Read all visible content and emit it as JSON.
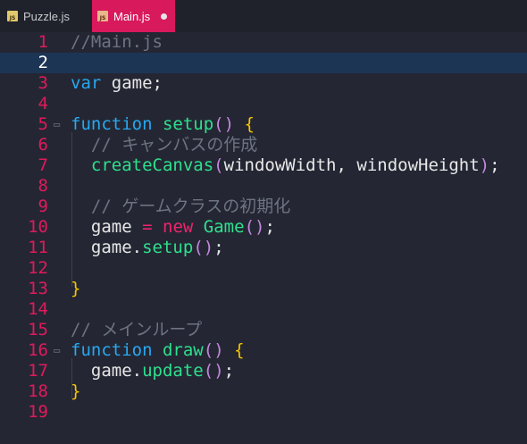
{
  "tabs": [
    {
      "label": "Puzzle.js",
      "icon": "js-file-icon",
      "icon_text": "JS",
      "active": false
    },
    {
      "label": "Main.js",
      "icon": "js-file-icon",
      "icon_text": "JS",
      "active": true,
      "modified": true
    }
  ],
  "editor": {
    "current_line": 2,
    "lines": [
      {
        "n": "1",
        "text": "//Main.js"
      },
      {
        "n": "2",
        "text": ""
      },
      {
        "n": "3",
        "text": "var game;"
      },
      {
        "n": "4",
        "text": ""
      },
      {
        "n": "5",
        "text": "function setup() {"
      },
      {
        "n": "6",
        "text": "  // キャンバスの作成"
      },
      {
        "n": "7",
        "text": "  createCanvas(windowWidth, windowHeight);"
      },
      {
        "n": "8",
        "text": ""
      },
      {
        "n": "9",
        "text": "  // ゲームクラスの初期化"
      },
      {
        "n": "10",
        "text": "  game = new Game();"
      },
      {
        "n": "11",
        "text": "  game.setup();"
      },
      {
        "n": "12",
        "text": ""
      },
      {
        "n": "13",
        "text": "}"
      },
      {
        "n": "14",
        "text": ""
      },
      {
        "n": "15",
        "text": "// メインループ"
      },
      {
        "n": "16",
        "text": "function draw() {"
      },
      {
        "n": "17",
        "text": "  game.update();"
      },
      {
        "n": "18",
        "text": "}"
      },
      {
        "n": "19",
        "text": ""
      }
    ]
  },
  "colors": {
    "background": "#242733",
    "active_tab": "#d8195b",
    "line_number": "#e01a5c",
    "keyword": "#27a8f0",
    "function": "#2ee08e",
    "bracket": "#f5c500",
    "paren": "#c586e0",
    "comment": "#6d7382"
  }
}
